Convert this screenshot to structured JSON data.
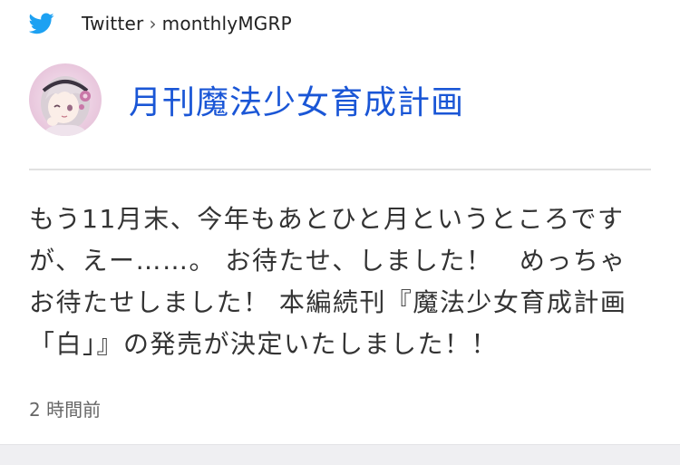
{
  "source": {
    "icon": "twitter-bird-icon",
    "network": "Twitter",
    "separator": "›",
    "handle": "monthlyMGRP"
  },
  "profile": {
    "avatar": "avatar",
    "name": "月刊魔法少女育成計画"
  },
  "tweet": {
    "text": "もう11月末、今年もあとひと月というところですが、えー……。 お待たせ、しました！　めっちゃお待たせしました！ 本編続刊『魔法少女育成計画「白」』の発売が決定いたしました！！",
    "time": "2 時間前"
  },
  "colors": {
    "twitter_blue": "#1da1f2",
    "link_blue": "#1a56d6",
    "divider": "#e1e1e1",
    "background_band": "#efeff2"
  }
}
